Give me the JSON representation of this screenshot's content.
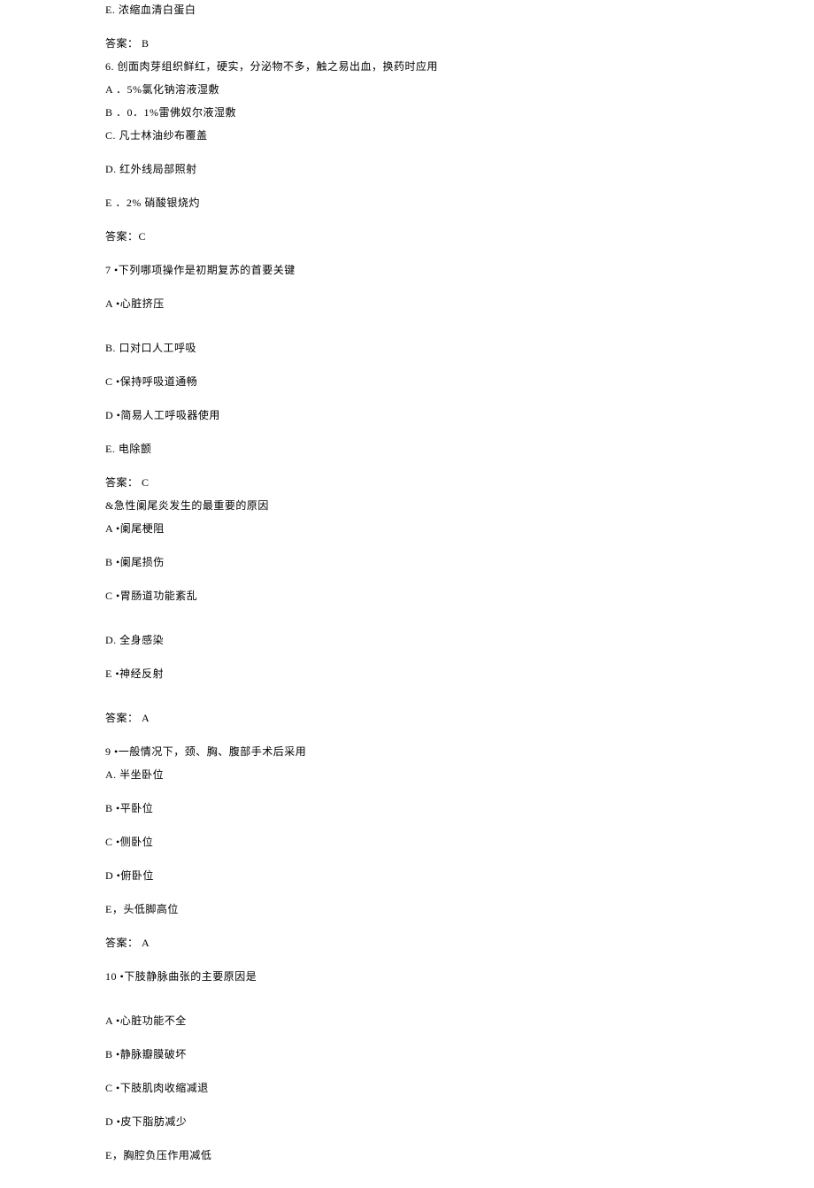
{
  "lines": [
    "E. 浓缩血清白蛋白",
    "",
    "答案： B",
    "6. 创面肉芽组织鲜红，硬实，分泌物不多，触之易出血，换药时应用",
    "A ．5%氯化钠溶液湿敷",
    "B ．0．1%雷佛奴尔液湿敷",
    "C.  凡士林油纱布覆盖",
    "",
    "D.  红外线局部照射",
    "",
    "E ．2% 硝酸银烧灼",
    "",
    "答案：C",
    "",
    "7 •下列哪项操作是初期复苏的首要关键",
    "",
    "A •心脏挤压",
    "",
    "",
    "B. 口对口人工呼吸",
    "",
    "C •保持呼吸道通畅",
    "",
    "D •简易人工呼吸器使用",
    "",
    "E. 电除颤",
    "",
    "答案： C",
    "&急性阑尾炎发生的最重要的原因",
    "A •阑尾梗阻",
    "",
    "B •阑尾损伤",
    "",
    "C •胃肠道功能紊乱",
    "",
    "",
    "D.  全身感染",
    "",
    "E •神经反射",
    "",
    "",
    "答案： A",
    "",
    "9 •一般情况下，颈、胸、腹部手术后采用",
    "A. 半坐卧位",
    "",
    "B •平卧位",
    "",
    "C •侧卧位",
    "",
    "D •俯卧位",
    "",
    "E，头低脚高位",
    "",
    "答案： A",
    "",
    "10 •下肢静脉曲张的主要原因是",
    "",
    "",
    "A •心脏功能不全",
    "",
    "B •静脉瓣膜破坏",
    "",
    "C •下肢肌肉收缩减退",
    "",
    "D •皮下脂肪减少",
    "",
    "E，胸腔负压作用减低"
  ]
}
